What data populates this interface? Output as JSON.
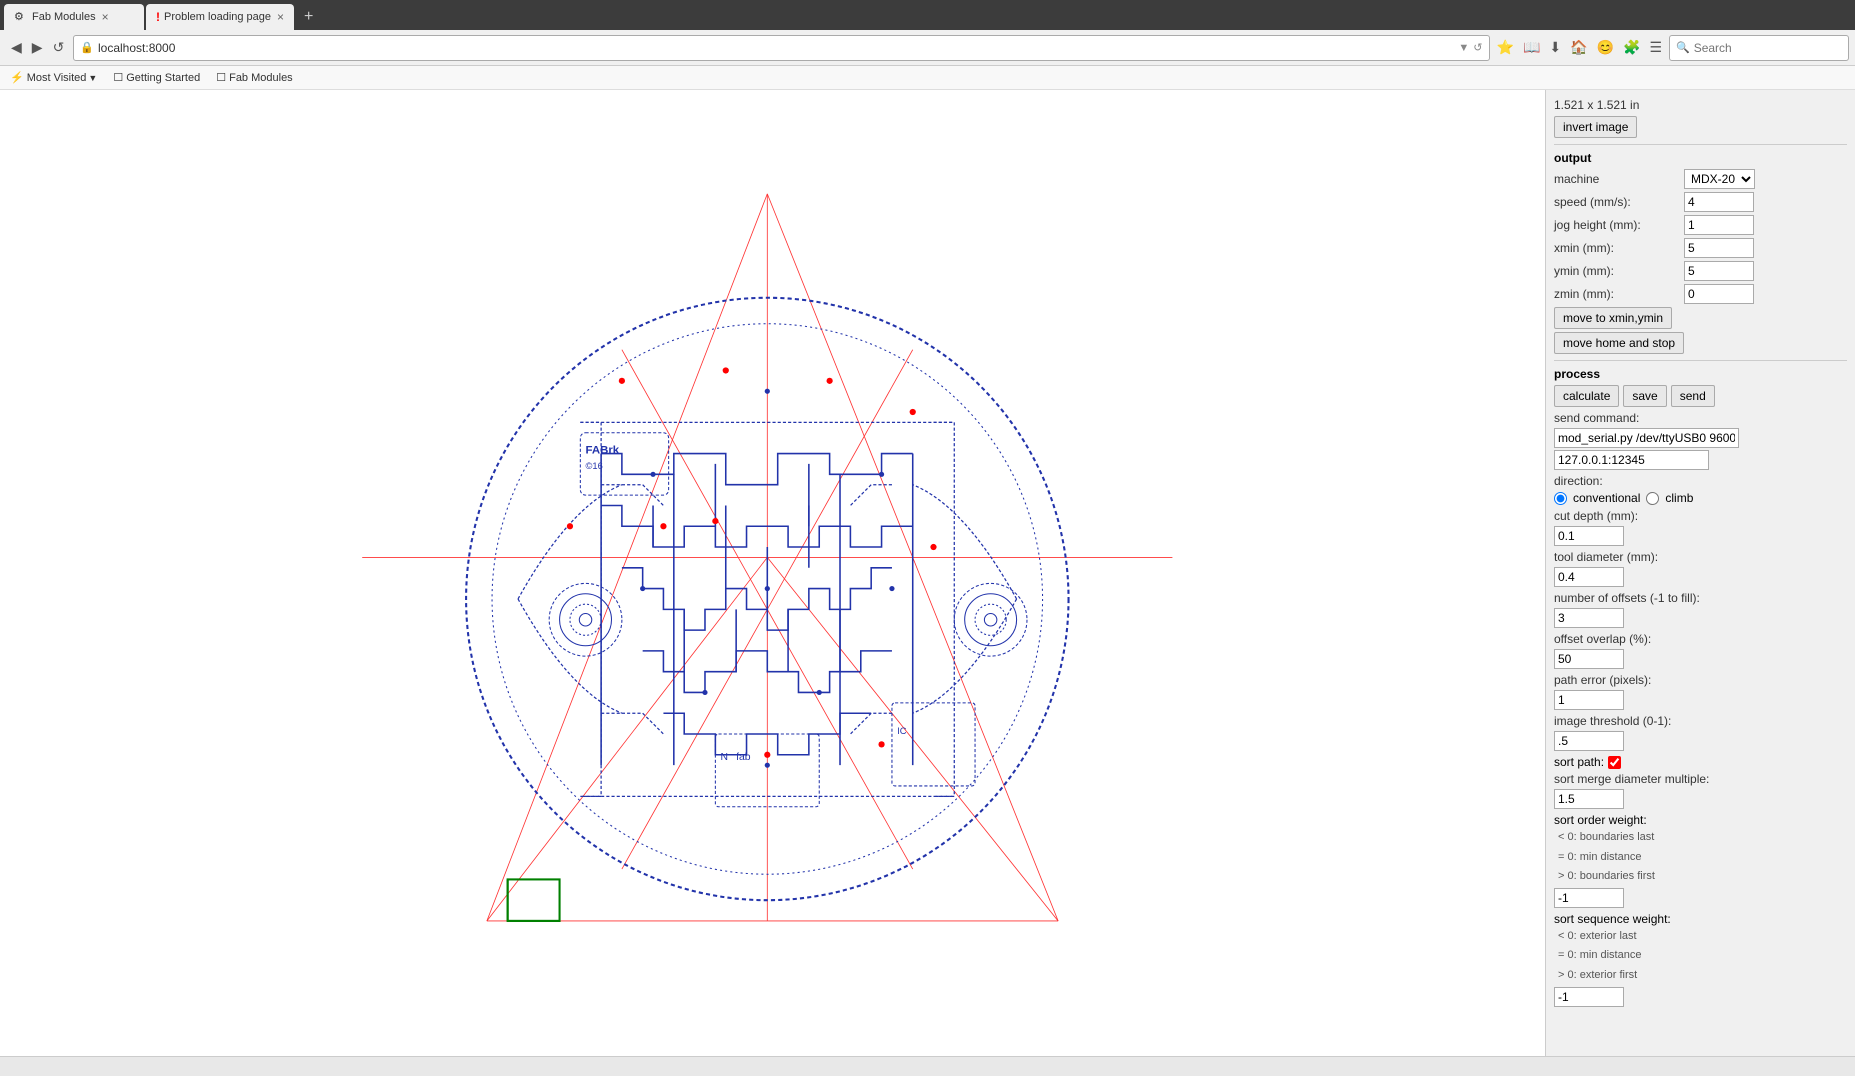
{
  "browser": {
    "tabs": [
      {
        "id": "fab-modules",
        "label": "Fab Modules",
        "active": true,
        "error": false,
        "favicon": "⚙"
      },
      {
        "id": "problem-loading",
        "label": "Problem loading page",
        "active": false,
        "error": true,
        "favicon": "!"
      }
    ],
    "new_tab_label": "+",
    "url": "localhost:8000",
    "search_placeholder": "Search",
    "nav_back": "◀",
    "nav_forward": "▶",
    "nav_reload": "↺",
    "nav_home": "🏠"
  },
  "bookmarks": [
    {
      "id": "most-visited",
      "label": "Most Visited",
      "has_arrow": true
    },
    {
      "id": "getting-started",
      "label": "Getting Started"
    },
    {
      "id": "fab-modules",
      "label": "Fab Modules"
    }
  ],
  "right_panel": {
    "dimensions": "1.521 x 1.521 in",
    "invert_image_btn": "invert image",
    "output_section": "output",
    "machine_label": "machine",
    "machine_value": "MDX-20",
    "speed_label": "speed (mm/s):",
    "speed_value": "4",
    "jog_height_label": "jog height (mm):",
    "jog_height_value": "1",
    "xmin_label": "xmin (mm):",
    "xmin_value": "5",
    "ymin_label": "ymin (mm):",
    "ymin_value": "5",
    "zmin_label": "zmin (mm):",
    "zmin_value": "0",
    "move_to_xmin_btn": "move to xmin,ymin",
    "move_home_btn": "move home and stop",
    "process_section": "process",
    "calculate_btn": "calculate",
    "save_btn": "save",
    "send_btn": "send",
    "send_command_label": "send command:",
    "send_command_value": "mod_serial.py /dev/ttyUSB0 9600",
    "send_command_ip": "127.0.0.1:12345",
    "direction_label": "direction:",
    "conventional_label": "conventional",
    "climb_label": "climb",
    "cut_depth_label": "cut depth (mm):",
    "cut_depth_value": "0.1",
    "tool_diameter_label": "tool diameter (mm):",
    "tool_diameter_value": "0.4",
    "num_offsets_label": "number of offsets (-1 to fill):",
    "num_offsets_value": "3",
    "offset_overlap_label": "offset overlap (%):",
    "offset_overlap_value": "50",
    "path_error_label": "path error (pixels):",
    "path_error_value": "1",
    "image_threshold_label": "image threshold (0-1):",
    "image_threshold_value": ".5",
    "sort_path_label": "sort path:",
    "sort_merge_label": "sort merge diameter multiple:",
    "sort_merge_value": "1.5",
    "sort_order_label": "sort order weight:",
    "sort_order_lines": [
      "< 0: boundaries last",
      "= 0: min distance",
      "> 0: boundaries first"
    ],
    "sort_order_value": "-1",
    "sort_sequence_label": "sort sequence weight:",
    "sort_sequence_lines": [
      "< 0: exterior last",
      "= 0: min distance",
      "> 0: exterior first"
    ],
    "sort_sequence_value": "-1"
  },
  "status_bar": {
    "text": ""
  }
}
